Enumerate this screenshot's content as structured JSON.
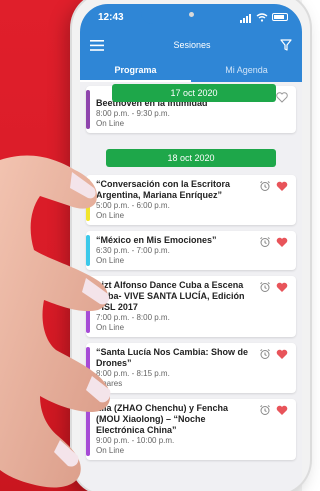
{
  "status_bar": {
    "time": "12:43"
  },
  "header": {
    "title": "Sesiones"
  },
  "tabs": [
    {
      "label": "Programa",
      "active": true
    },
    {
      "label": "Mi Agenda",
      "active": false
    }
  ],
  "top_card": {
    "title": "Beethoven en la intimidad",
    "time": "8:00 p.m. - 9:30 p.m.",
    "place": "On Line",
    "stripe_color": "#8e44ad"
  },
  "date_headers": [
    "17 oct 2020",
    "18 oct 2020"
  ],
  "sessions": [
    {
      "title": "“Conversación con la Escritora Argentina, Mariana Enríquez”",
      "time": "5:00 p.m. - 6:00 p.m.",
      "place": "On Line",
      "stripe_color": "#f1e52c",
      "favorite": true
    },
    {
      "title": "“México en Mis Emociones”",
      "time": "6:30 p.m. - 7:00 p.m.",
      "place": "On Line",
      "stripe_color": "#3bc8ea",
      "favorite": true
    },
    {
      "title": "Lizt Alfonso Dance Cuba a Escena Cuba- VIVE SANTA LUCÍA, Edición FISL 2017",
      "time": "7:00 p.m. - 8:00 p.m.",
      "place": "On Line",
      "stripe_color": "#a64bd6",
      "favorite": true
    },
    {
      "title": "“Santa Lucía Nos Cambia: Show de Drones”",
      "time": "8:00 p.m. - 8:15 p.m.",
      "place": "Linares",
      "stripe_color": "#a64bd6",
      "favorite": true
    },
    {
      "title": "Lila (ZHAO Chenchu) y Fencha (MOU Xiaolong) – “Noche Electrónica China”",
      "time": "9:00 p.m. - 10:00 p.m.",
      "place": "On Line",
      "stripe_color": "#a64bd6",
      "favorite": true
    }
  ],
  "colors": {
    "primary": "#2f86d6",
    "date_bar": "#1ea74a",
    "heart": "#e8545a",
    "background_red": "#d81b27"
  },
  "icons": [
    "menu-icon",
    "filter-icon",
    "alarm-icon",
    "heart-icon"
  ]
}
